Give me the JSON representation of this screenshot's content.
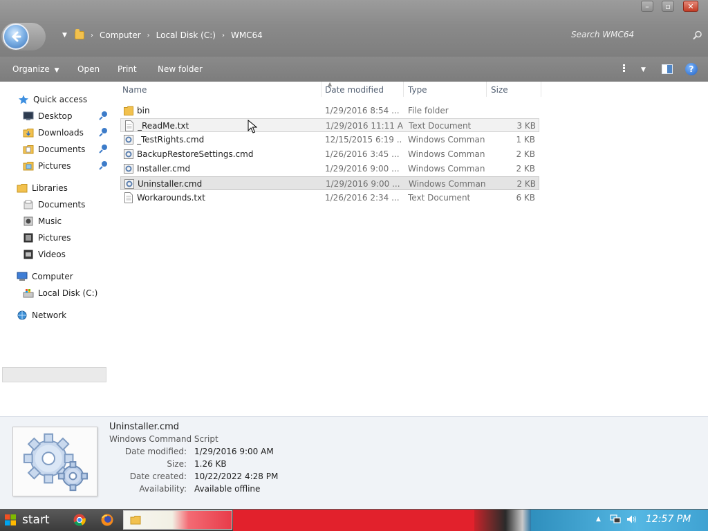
{
  "breadcrumb": [
    "Computer",
    "Local Disk (C:)",
    "WMC64"
  ],
  "search": {
    "placeholder": "Search WMC64"
  },
  "toolbar": {
    "organize": "Organize",
    "open": "Open",
    "print": "Print",
    "new_folder": "New folder"
  },
  "nav": {
    "quick_access": "Quick access",
    "desktop": "Desktop",
    "downloads": "Downloads",
    "documents": "Documents",
    "pictures": "Pictures",
    "libraries": "Libraries",
    "lib_documents": "Documents",
    "lib_music": "Music",
    "lib_pictures": "Pictures",
    "lib_videos": "Videos",
    "computer": "Computer",
    "local_disk": "Local Disk (C:)",
    "network": "Network"
  },
  "columns": {
    "name": "Name",
    "date": "Date modified",
    "type": "Type",
    "size": "Size"
  },
  "files": [
    {
      "name": "bin",
      "date": "1/29/2016 8:54 ...",
      "type": "File folder",
      "size": "",
      "icon": "folder-icon"
    },
    {
      "name": "_ReadMe.txt",
      "date": "1/29/2016 11:11 A...",
      "type": "Text Document",
      "size": "3 KB",
      "icon": "text-file-icon"
    },
    {
      "name": "_TestRights.cmd",
      "date": "12/15/2015 6:19 ...",
      "type": "Windows Comman...",
      "size": "1 KB",
      "icon": "cmd-file-icon"
    },
    {
      "name": "BackupRestoreSettings.cmd",
      "date": "1/26/2016 3:45 ...",
      "type": "Windows Comman...",
      "size": "2 KB",
      "icon": "cmd-file-icon"
    },
    {
      "name": "Installer.cmd",
      "date": "1/29/2016 9:00 ...",
      "type": "Windows Comman...",
      "size": "2 KB",
      "icon": "cmd-file-icon"
    },
    {
      "name": "Uninstaller.cmd",
      "date": "1/29/2016 9:00 ...",
      "type": "Windows Comman...",
      "size": "2 KB",
      "icon": "cmd-file-icon"
    },
    {
      "name": "Workarounds.txt",
      "date": "1/26/2016 2:34 ...",
      "type": "Text Document",
      "size": "6 KB",
      "icon": "text-file-icon"
    }
  ],
  "details": {
    "title": "Uninstaller.cmd",
    "subtitle": "Windows Command Script",
    "date_modified_label": "Date modified:",
    "date_modified": "1/29/2016 9:00 AM",
    "size_label": "Size:",
    "size": "1.26 KB",
    "date_created_label": "Date created:",
    "date_created": "10/22/2022 4:28 PM",
    "availability_label": "Availability:",
    "availability": "Available offline"
  },
  "taskbar": {
    "start": "start",
    "clock": "12:57 PM"
  },
  "colors": {
    "chrome": "#8a8a8a",
    "accent": "#3b73b8",
    "taskbar_red": "#e2212c"
  }
}
